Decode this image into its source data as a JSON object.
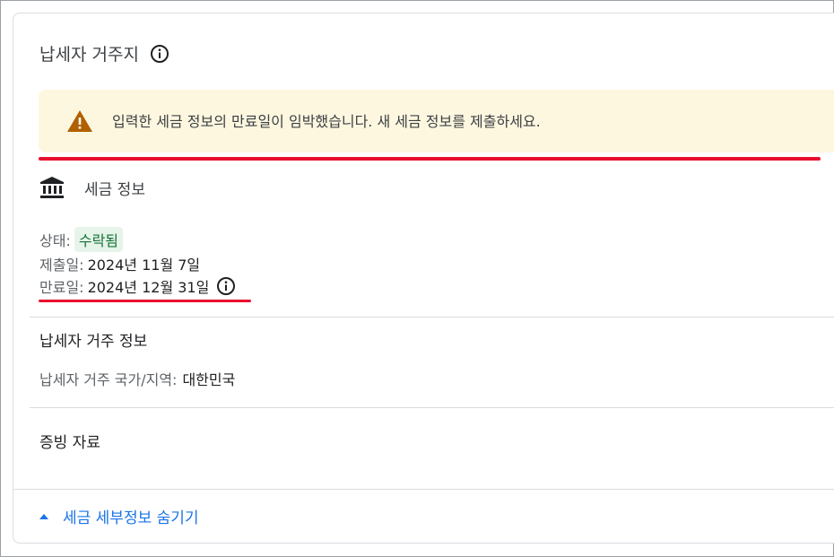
{
  "header": {
    "title": "납세자 거주지"
  },
  "alert": {
    "message": "입력한 세금 정보의 만료일이 임박했습니다. 새 세금 정보를 제출하세요."
  },
  "tax_info": {
    "heading": "세금 정보",
    "status_label": "상태:",
    "status_value": "수락됨",
    "submitted_label": "제출일:",
    "submitted_value": "2024년 11월 7일",
    "expiry_label": "만료일:",
    "expiry_value": "2024년 12월 31일"
  },
  "residency": {
    "heading": "납세자 거주 정보",
    "country_label": "납세자 거주 국가/지역:",
    "country_value": "대한민국"
  },
  "evidence": {
    "heading": "증빙 자료"
  },
  "footer": {
    "toggle_label": "세금 세부정보 숨기기"
  },
  "colors": {
    "accent": "#1a73e8",
    "warning": "#b06000",
    "warning_bg": "#fef7e0",
    "success": "#137333",
    "annotation": "#e8102f"
  }
}
